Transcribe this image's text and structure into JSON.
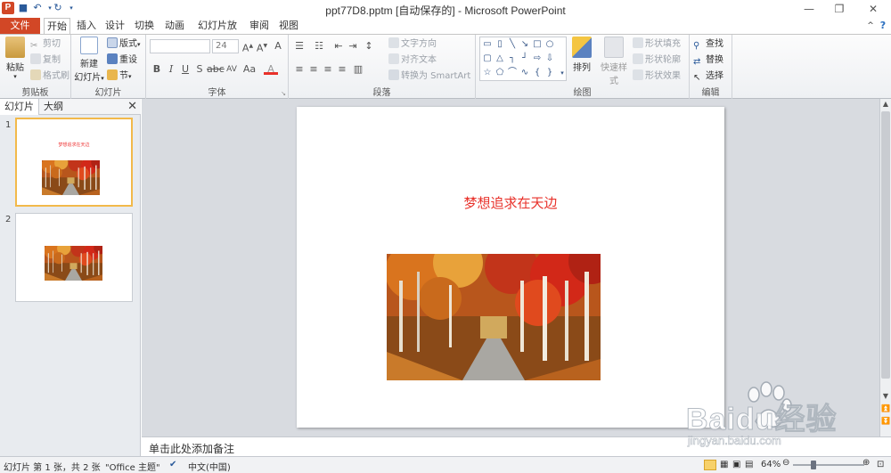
{
  "window": {
    "title": "ppt77D8.pptm [自动保存的] - Microsoft PowerPoint",
    "logo_letter": "P"
  },
  "tabs": [
    "文件",
    "开始",
    "插入",
    "设计",
    "切换",
    "动画",
    "幻灯片放映",
    "审阅",
    "视图"
  ],
  "ribbon": {
    "clipboard": {
      "label": "剪贴板",
      "paste": "粘贴",
      "cut": "剪切",
      "copy": "复制",
      "format_painter": "格式刷"
    },
    "slides": {
      "label": "幻灯片",
      "new_slide_1": "新建",
      "new_slide_2": "幻灯片",
      "layout": "版式",
      "reset": "重设",
      "section": "节"
    },
    "font": {
      "label": "字体",
      "font_name": "",
      "font_size": "24"
    },
    "paragraph": {
      "label": "段落",
      "text_direction": "文字方向",
      "align_text": "对齐文本",
      "smartart": "转换为 SmartArt"
    },
    "drawing": {
      "label": "绘图",
      "arrange": "排列",
      "quick_styles": "快速样式",
      "shape_fill": "形状填充",
      "shape_outline": "形状轮廓",
      "shape_effects": "形状效果"
    },
    "editing": {
      "label": "编辑",
      "find": "查找",
      "replace": "替换",
      "select": "选择"
    }
  },
  "left_pane": {
    "tabs": [
      "幻灯片",
      "大纲"
    ],
    "thumbs": [
      {
        "num": "1",
        "title": "梦想追求在天边"
      },
      {
        "num": "2",
        "title": ""
      }
    ]
  },
  "slide": {
    "title": "梦想追求在天边"
  },
  "notes": {
    "placeholder": "单击此处添加备注"
  },
  "status": {
    "slide_info": "幻灯片 第 1 张，共 2 张",
    "theme": "\"Office 主题\"",
    "language": "中文(中国)",
    "zoom": "64%"
  },
  "watermark": {
    "brand": "Baidu经验",
    "url": "jingyan.baidu.com"
  },
  "colors": {
    "accent": "#d24726",
    "title_red": "#e8312a"
  }
}
